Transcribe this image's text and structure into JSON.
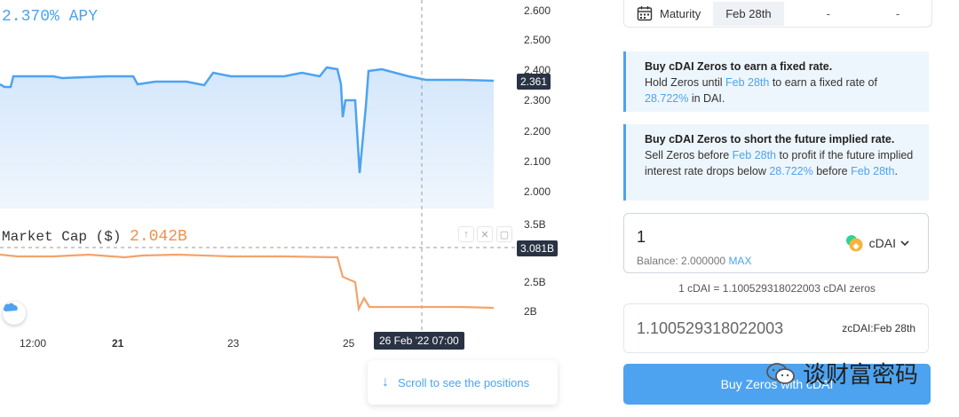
{
  "chart": {
    "apy_label": "2.370% APY",
    "mcap_label": "Market Cap ($)",
    "mcap_value": "2.042B",
    "apy_axis": [
      "2.600",
      "2.500",
      "2.400",
      "2.300",
      "2.200",
      "2.100",
      "2.000"
    ],
    "apy_current": "2.361",
    "mcap_axis": [
      "3.5B",
      "2.5B",
      "2B"
    ],
    "mcap_current": "3.081B",
    "x_labels": [
      "12:00",
      "21",
      "23",
      "25"
    ],
    "crosshair_time": "26 Feb '22   07:00",
    "controls": [
      "↑",
      "✕",
      "▢"
    ]
  },
  "scroll_hint": "Scroll to see the positions",
  "maturity": {
    "label": "Maturity",
    "value": "Feb 28th",
    "dash1": "-",
    "dash2": "-"
  },
  "info_fixed": {
    "heading": "Buy cDAI Zeros to earn a fixed rate.",
    "t1": "Hold Zeros until ",
    "date": "Feb 28th",
    "t2": " to earn a fixed rate of ",
    "rate": "28.722%",
    "t3": " in DAI."
  },
  "info_short": {
    "heading": "Buy cDAI Zeros to short the future implied rate.",
    "t1": "Sell Zeros before ",
    "date": "Feb 28th",
    "t2": " to profit if the future implied interest rate drops below ",
    "rate": "28.722%",
    "t3": " before ",
    "date2": "Feb 28th",
    "t4": "."
  },
  "input": {
    "amount": "1",
    "balance_label": "Balance: 2.000000",
    "max_label": "MAX",
    "token": "cDAI"
  },
  "conversion": "1 cDAI = 1.100529318022003 cDAI zeros",
  "output": {
    "amount": "1.100529318022003",
    "token": "zcDAI:Feb 28th"
  },
  "buy_button": "Buy Zeros with cDAI",
  "watermark": "谈财富密码",
  "colors": {
    "accent": "#4da3f0",
    "orange": "#f0924a",
    "dark_tag": "#2a3344"
  }
}
